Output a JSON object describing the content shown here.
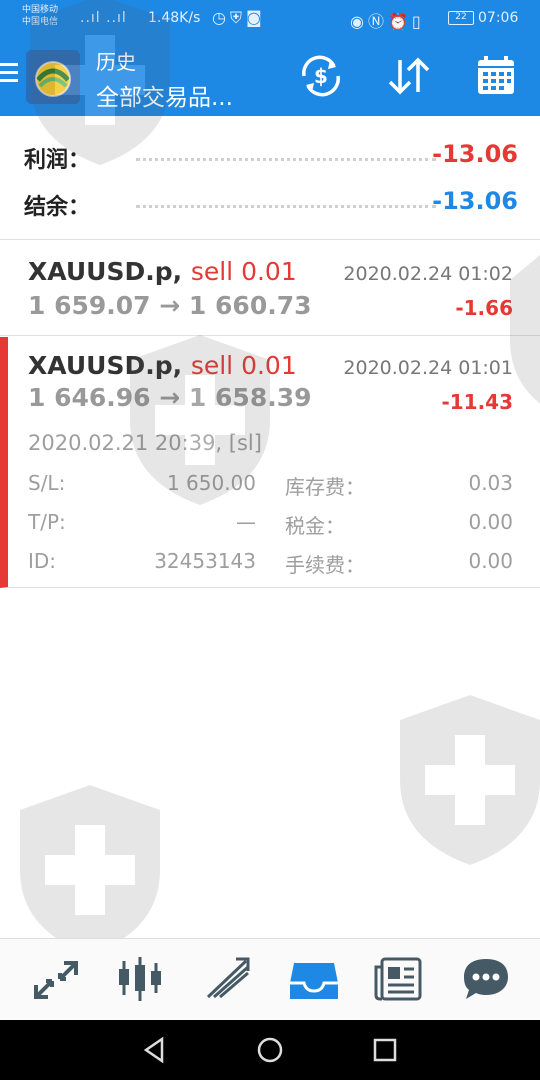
{
  "status_bar": {
    "carrier1": "中国移动",
    "carrier2": "中国电信",
    "signal": "..ıl ..ıl",
    "speed": "1.48K/s",
    "battery": "22",
    "time": "07:06"
  },
  "app_bar": {
    "title": "历史",
    "subtitle": "全部交易品..."
  },
  "summary": {
    "profit_label": "利润：",
    "profit_value": "-13.06",
    "balance_label": "结余：",
    "balance_value": "-13.06"
  },
  "trades": [
    {
      "symbol": "XAUUSD.p,",
      "side": "sell 0.01",
      "time": "2020.02.24 01:02",
      "prices": "1 659.07 → 1 660.73",
      "profit": "-1.66"
    },
    {
      "symbol": "XAUUSD.p,",
      "side": "sell 0.01",
      "time": "2020.02.24 01:01",
      "prices": "1 646.96 → 1 658.39",
      "profit": "-11.43",
      "open_time": "2020.02.21 20:39, [sl]",
      "details": {
        "sl_label": "S/L:",
        "sl_value": "1 650.00",
        "tp_label": "T/P:",
        "tp_value": "—",
        "id_label": "ID:",
        "id_value": "32453143",
        "swap_label": "库存费：",
        "swap_value": "0.03",
        "tax_label": "税金：",
        "tax_value": "0.00",
        "commission_label": "手续费：",
        "commission_value": "0.00"
      }
    }
  ],
  "colors": {
    "primary": "#1e88e5",
    "loss": "#e53935",
    "balance": "#1e88e5"
  },
  "icons": {
    "menu": "hamburger-icon",
    "deposit": "dollar-exchange-icon",
    "sort": "sort-arrows-icon",
    "calendar": "calendar-icon",
    "nav": [
      "quotes-icon",
      "chart-candles-icon",
      "trade-icon",
      "history-inbox-icon",
      "news-icon",
      "chat-icon"
    ]
  }
}
